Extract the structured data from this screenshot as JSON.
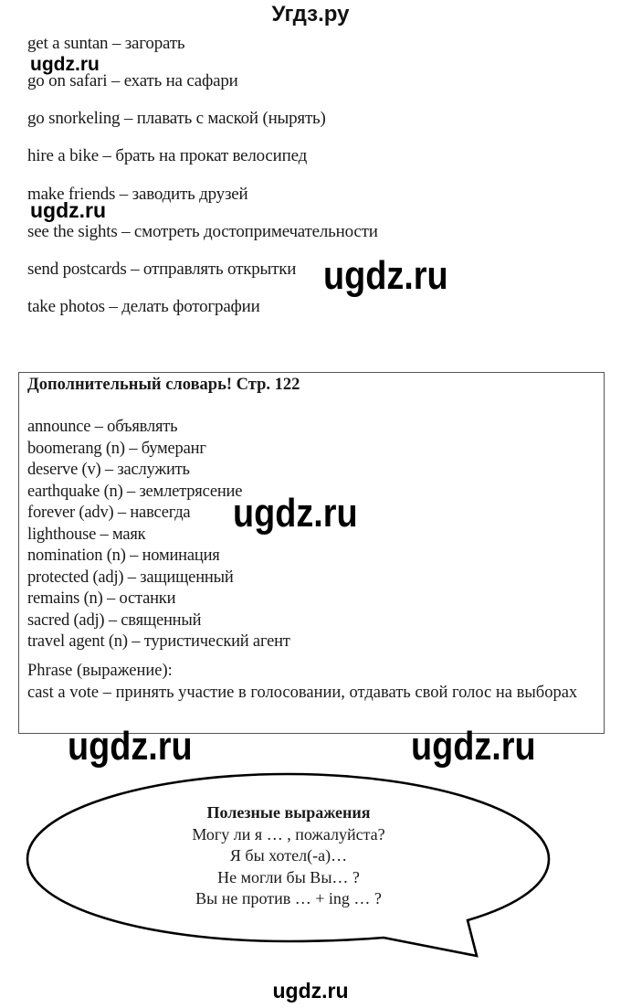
{
  "header": {
    "title": "Угдз.ру"
  },
  "phrases": [
    {
      "text": "get a suntan – загорать"
    },
    {
      "text": "go on safari – ехать на сафари"
    },
    {
      "text": "go snorkeling – плавать с маской (нырять)"
    },
    {
      "text": "hire a bike – брать на прокат велосипед"
    },
    {
      "text": "make friends – заводить друзей"
    },
    {
      "text": "see the sights – смотреть достопримечательности"
    },
    {
      "text": "send postcards – отправлять открытки"
    },
    {
      "text": "take photos – делать фотографии"
    }
  ],
  "vocab_box": {
    "title": "Дополнительный словарь! Стр. 122",
    "items": [
      "announce – объявлять",
      "boomerang (n) – бумеранг",
      "deserve (v) – заслужить",
      "earthquake (n) – землетрясение",
      "forever (adv) – навсегда",
      "lighthouse – маяк",
      "nomination (n) – номинация",
      "protected (adj) – защищенный",
      "remains (n) – останки",
      "sacred (adj) – священный",
      "travel agent (n) – туристический агент"
    ],
    "phrase_label": "Phrase (выражение):",
    "phrase_text": "cast a vote – принять участие в голосовании, отдавать свой голос на выборах"
  },
  "bubble": {
    "title": "Полезные выражения",
    "lines": [
      "Могу ли я … , пожалуйста?",
      "Я бы хотел(-а)…",
      "Не могли бы Вы… ?",
      "Вы не против … + ing … ?"
    ]
  },
  "watermarks": {
    "small": "ugdz.ru",
    "big": "ugdz.ru",
    "footer": "ugdz.ru"
  }
}
